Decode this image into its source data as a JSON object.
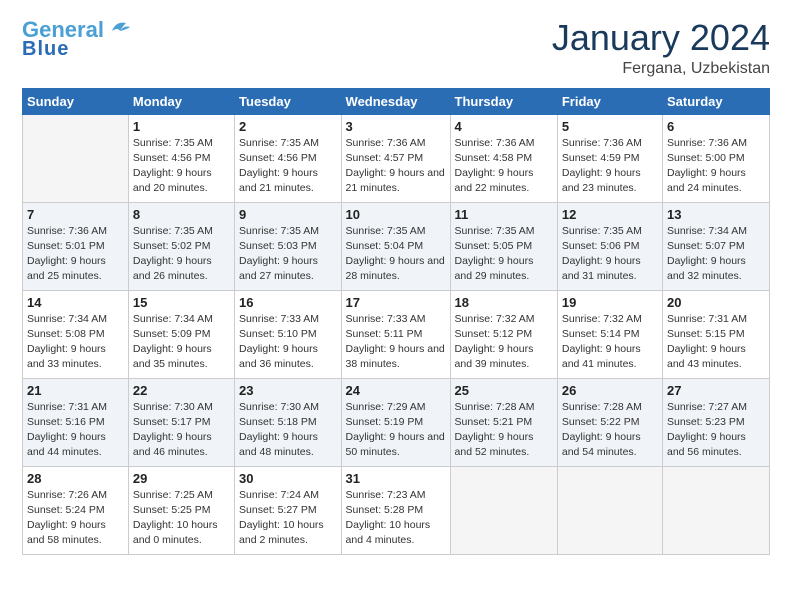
{
  "header": {
    "logo_line1": "General",
    "logo_line2": "Blue",
    "title": "January 2024",
    "subtitle": "Fergana, Uzbekistan"
  },
  "days_of_week": [
    "Sunday",
    "Monday",
    "Tuesday",
    "Wednesday",
    "Thursday",
    "Friday",
    "Saturday"
  ],
  "weeks": [
    [
      {
        "day": "",
        "empty": true
      },
      {
        "day": "1",
        "sunrise": "7:35 AM",
        "sunset": "4:56 PM",
        "daylight": "9 hours and 20 minutes."
      },
      {
        "day": "2",
        "sunrise": "7:35 AM",
        "sunset": "4:56 PM",
        "daylight": "9 hours and 21 minutes."
      },
      {
        "day": "3",
        "sunrise": "7:36 AM",
        "sunset": "4:57 PM",
        "daylight": "9 hours and 21 minutes."
      },
      {
        "day": "4",
        "sunrise": "7:36 AM",
        "sunset": "4:58 PM",
        "daylight": "9 hours and 22 minutes."
      },
      {
        "day": "5",
        "sunrise": "7:36 AM",
        "sunset": "4:59 PM",
        "daylight": "9 hours and 23 minutes."
      },
      {
        "day": "6",
        "sunrise": "7:36 AM",
        "sunset": "5:00 PM",
        "daylight": "9 hours and 24 minutes."
      }
    ],
    [
      {
        "day": "7",
        "sunrise": "7:36 AM",
        "sunset": "5:01 PM",
        "daylight": "9 hours and 25 minutes."
      },
      {
        "day": "8",
        "sunrise": "7:35 AM",
        "sunset": "5:02 PM",
        "daylight": "9 hours and 26 minutes."
      },
      {
        "day": "9",
        "sunrise": "7:35 AM",
        "sunset": "5:03 PM",
        "daylight": "9 hours and 27 minutes."
      },
      {
        "day": "10",
        "sunrise": "7:35 AM",
        "sunset": "5:04 PM",
        "daylight": "9 hours and 28 minutes."
      },
      {
        "day": "11",
        "sunrise": "7:35 AM",
        "sunset": "5:05 PM",
        "daylight": "9 hours and 29 minutes."
      },
      {
        "day": "12",
        "sunrise": "7:35 AM",
        "sunset": "5:06 PM",
        "daylight": "9 hours and 31 minutes."
      },
      {
        "day": "13",
        "sunrise": "7:34 AM",
        "sunset": "5:07 PM",
        "daylight": "9 hours and 32 minutes."
      }
    ],
    [
      {
        "day": "14",
        "sunrise": "7:34 AM",
        "sunset": "5:08 PM",
        "daylight": "9 hours and 33 minutes."
      },
      {
        "day": "15",
        "sunrise": "7:34 AM",
        "sunset": "5:09 PM",
        "daylight": "9 hours and 35 minutes."
      },
      {
        "day": "16",
        "sunrise": "7:33 AM",
        "sunset": "5:10 PM",
        "daylight": "9 hours and 36 minutes."
      },
      {
        "day": "17",
        "sunrise": "7:33 AM",
        "sunset": "5:11 PM",
        "daylight": "9 hours and 38 minutes."
      },
      {
        "day": "18",
        "sunrise": "7:32 AM",
        "sunset": "5:12 PM",
        "daylight": "9 hours and 39 minutes."
      },
      {
        "day": "19",
        "sunrise": "7:32 AM",
        "sunset": "5:14 PM",
        "daylight": "9 hours and 41 minutes."
      },
      {
        "day": "20",
        "sunrise": "7:31 AM",
        "sunset": "5:15 PM",
        "daylight": "9 hours and 43 minutes."
      }
    ],
    [
      {
        "day": "21",
        "sunrise": "7:31 AM",
        "sunset": "5:16 PM",
        "daylight": "9 hours and 44 minutes."
      },
      {
        "day": "22",
        "sunrise": "7:30 AM",
        "sunset": "5:17 PM",
        "daylight": "9 hours and 46 minutes."
      },
      {
        "day": "23",
        "sunrise": "7:30 AM",
        "sunset": "5:18 PM",
        "daylight": "9 hours and 48 minutes."
      },
      {
        "day": "24",
        "sunrise": "7:29 AM",
        "sunset": "5:19 PM",
        "daylight": "9 hours and 50 minutes."
      },
      {
        "day": "25",
        "sunrise": "7:28 AM",
        "sunset": "5:21 PM",
        "daylight": "9 hours and 52 minutes."
      },
      {
        "day": "26",
        "sunrise": "7:28 AM",
        "sunset": "5:22 PM",
        "daylight": "9 hours and 54 minutes."
      },
      {
        "day": "27",
        "sunrise": "7:27 AM",
        "sunset": "5:23 PM",
        "daylight": "9 hours and 56 minutes."
      }
    ],
    [
      {
        "day": "28",
        "sunrise": "7:26 AM",
        "sunset": "5:24 PM",
        "daylight": "9 hours and 58 minutes."
      },
      {
        "day": "29",
        "sunrise": "7:25 AM",
        "sunset": "5:25 PM",
        "daylight": "10 hours and 0 minutes."
      },
      {
        "day": "30",
        "sunrise": "7:24 AM",
        "sunset": "5:27 PM",
        "daylight": "10 hours and 2 minutes."
      },
      {
        "day": "31",
        "sunrise": "7:23 AM",
        "sunset": "5:28 PM",
        "daylight": "10 hours and 4 minutes."
      },
      {
        "day": "",
        "empty": true
      },
      {
        "day": "",
        "empty": true
      },
      {
        "day": "",
        "empty": true
      }
    ]
  ]
}
